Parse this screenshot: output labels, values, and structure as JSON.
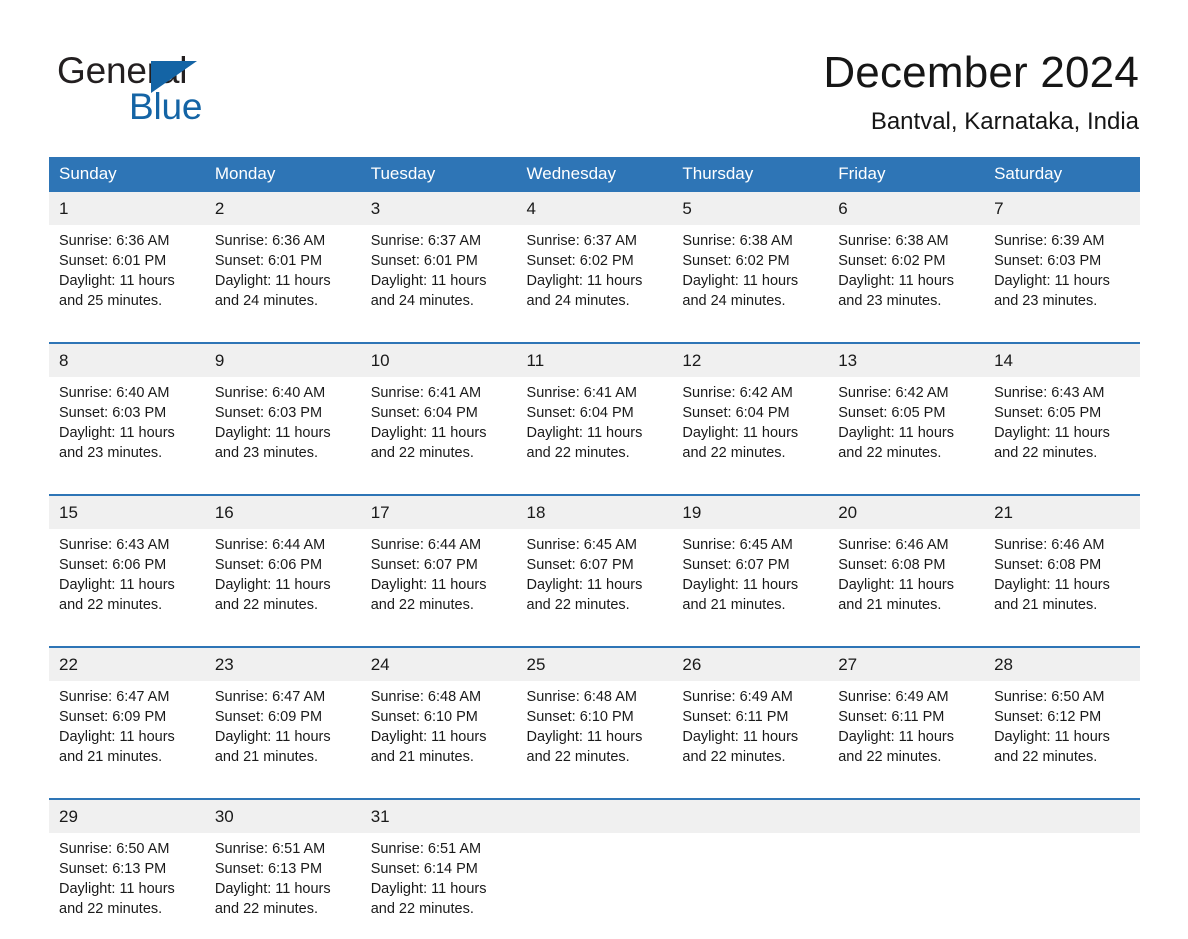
{
  "brand": {
    "name_part1": "General",
    "name_part2": "Blue",
    "triangle_icon": "triangle-play-icon",
    "accent_color": "#1464a5"
  },
  "header": {
    "title": "December 2024",
    "location": "Bantval, Karnataka, India"
  },
  "theme": {
    "header_blue": "#2e75b6",
    "daynum_band": "#f0f0f0",
    "text": "#1a1a1a",
    "page_background": "#ffffff"
  },
  "calendar": {
    "weekday_headers": [
      "Sunday",
      "Monday",
      "Tuesday",
      "Wednesday",
      "Thursday",
      "Friday",
      "Saturday"
    ],
    "weeks": [
      {
        "days": [
          {
            "date": "1",
            "sunrise": "Sunrise: 6:36 AM",
            "sunset": "Sunset: 6:01 PM",
            "daylight_line1": "Daylight: 11 hours",
            "daylight_line2": "and 25 minutes."
          },
          {
            "date": "2",
            "sunrise": "Sunrise: 6:36 AM",
            "sunset": "Sunset: 6:01 PM",
            "daylight_line1": "Daylight: 11 hours",
            "daylight_line2": "and 24 minutes."
          },
          {
            "date": "3",
            "sunrise": "Sunrise: 6:37 AM",
            "sunset": "Sunset: 6:01 PM",
            "daylight_line1": "Daylight: 11 hours",
            "daylight_line2": "and 24 minutes."
          },
          {
            "date": "4",
            "sunrise": "Sunrise: 6:37 AM",
            "sunset": "Sunset: 6:02 PM",
            "daylight_line1": "Daylight: 11 hours",
            "daylight_line2": "and 24 minutes."
          },
          {
            "date": "5",
            "sunrise": "Sunrise: 6:38 AM",
            "sunset": "Sunset: 6:02 PM",
            "daylight_line1": "Daylight: 11 hours",
            "daylight_line2": "and 24 minutes."
          },
          {
            "date": "6",
            "sunrise": "Sunrise: 6:38 AM",
            "sunset": "Sunset: 6:02 PM",
            "daylight_line1": "Daylight: 11 hours",
            "daylight_line2": "and 23 minutes."
          },
          {
            "date": "7",
            "sunrise": "Sunrise: 6:39 AM",
            "sunset": "Sunset: 6:03 PM",
            "daylight_line1": "Daylight: 11 hours",
            "daylight_line2": "and 23 minutes."
          }
        ]
      },
      {
        "days": [
          {
            "date": "8",
            "sunrise": "Sunrise: 6:40 AM",
            "sunset": "Sunset: 6:03 PM",
            "daylight_line1": "Daylight: 11 hours",
            "daylight_line2": "and 23 minutes."
          },
          {
            "date": "9",
            "sunrise": "Sunrise: 6:40 AM",
            "sunset": "Sunset: 6:03 PM",
            "daylight_line1": "Daylight: 11 hours",
            "daylight_line2": "and 23 minutes."
          },
          {
            "date": "10",
            "sunrise": "Sunrise: 6:41 AM",
            "sunset": "Sunset: 6:04 PM",
            "daylight_line1": "Daylight: 11 hours",
            "daylight_line2": "and 22 minutes."
          },
          {
            "date": "11",
            "sunrise": "Sunrise: 6:41 AM",
            "sunset": "Sunset: 6:04 PM",
            "daylight_line1": "Daylight: 11 hours",
            "daylight_line2": "and 22 minutes."
          },
          {
            "date": "12",
            "sunrise": "Sunrise: 6:42 AM",
            "sunset": "Sunset: 6:04 PM",
            "daylight_line1": "Daylight: 11 hours",
            "daylight_line2": "and 22 minutes."
          },
          {
            "date": "13",
            "sunrise": "Sunrise: 6:42 AM",
            "sunset": "Sunset: 6:05 PM",
            "daylight_line1": "Daylight: 11 hours",
            "daylight_line2": "and 22 minutes."
          },
          {
            "date": "14",
            "sunrise": "Sunrise: 6:43 AM",
            "sunset": "Sunset: 6:05 PM",
            "daylight_line1": "Daylight: 11 hours",
            "daylight_line2": "and 22 minutes."
          }
        ]
      },
      {
        "days": [
          {
            "date": "15",
            "sunrise": "Sunrise: 6:43 AM",
            "sunset": "Sunset: 6:06 PM",
            "daylight_line1": "Daylight: 11 hours",
            "daylight_line2": "and 22 minutes."
          },
          {
            "date": "16",
            "sunrise": "Sunrise: 6:44 AM",
            "sunset": "Sunset: 6:06 PM",
            "daylight_line1": "Daylight: 11 hours",
            "daylight_line2": "and 22 minutes."
          },
          {
            "date": "17",
            "sunrise": "Sunrise: 6:44 AM",
            "sunset": "Sunset: 6:07 PM",
            "daylight_line1": "Daylight: 11 hours",
            "daylight_line2": "and 22 minutes."
          },
          {
            "date": "18",
            "sunrise": "Sunrise: 6:45 AM",
            "sunset": "Sunset: 6:07 PM",
            "daylight_line1": "Daylight: 11 hours",
            "daylight_line2": "and 22 minutes."
          },
          {
            "date": "19",
            "sunrise": "Sunrise: 6:45 AM",
            "sunset": "Sunset: 6:07 PM",
            "daylight_line1": "Daylight: 11 hours",
            "daylight_line2": "and 21 minutes."
          },
          {
            "date": "20",
            "sunrise": "Sunrise: 6:46 AM",
            "sunset": "Sunset: 6:08 PM",
            "daylight_line1": "Daylight: 11 hours",
            "daylight_line2": "and 21 minutes."
          },
          {
            "date": "21",
            "sunrise": "Sunrise: 6:46 AM",
            "sunset": "Sunset: 6:08 PM",
            "daylight_line1": "Daylight: 11 hours",
            "daylight_line2": "and 21 minutes."
          }
        ]
      },
      {
        "days": [
          {
            "date": "22",
            "sunrise": "Sunrise: 6:47 AM",
            "sunset": "Sunset: 6:09 PM",
            "daylight_line1": "Daylight: 11 hours",
            "daylight_line2": "and 21 minutes."
          },
          {
            "date": "23",
            "sunrise": "Sunrise: 6:47 AM",
            "sunset": "Sunset: 6:09 PM",
            "daylight_line1": "Daylight: 11 hours",
            "daylight_line2": "and 21 minutes."
          },
          {
            "date": "24",
            "sunrise": "Sunrise: 6:48 AM",
            "sunset": "Sunset: 6:10 PM",
            "daylight_line1": "Daylight: 11 hours",
            "daylight_line2": "and 21 minutes."
          },
          {
            "date": "25",
            "sunrise": "Sunrise: 6:48 AM",
            "sunset": "Sunset: 6:10 PM",
            "daylight_line1": "Daylight: 11 hours",
            "daylight_line2": "and 22 minutes."
          },
          {
            "date": "26",
            "sunrise": "Sunrise: 6:49 AM",
            "sunset": "Sunset: 6:11 PM",
            "daylight_line1": "Daylight: 11 hours",
            "daylight_line2": "and 22 minutes."
          },
          {
            "date": "27",
            "sunrise": "Sunrise: 6:49 AM",
            "sunset": "Sunset: 6:11 PM",
            "daylight_line1": "Daylight: 11 hours",
            "daylight_line2": "and 22 minutes."
          },
          {
            "date": "28",
            "sunrise": "Sunrise: 6:50 AM",
            "sunset": "Sunset: 6:12 PM",
            "daylight_line1": "Daylight: 11 hours",
            "daylight_line2": "and 22 minutes."
          }
        ]
      },
      {
        "days": [
          {
            "date": "29",
            "sunrise": "Sunrise: 6:50 AM",
            "sunset": "Sunset: 6:13 PM",
            "daylight_line1": "Daylight: 11 hours",
            "daylight_line2": "and 22 minutes."
          },
          {
            "date": "30",
            "sunrise": "Sunrise: 6:51 AM",
            "sunset": "Sunset: 6:13 PM",
            "daylight_line1": "Daylight: 11 hours",
            "daylight_line2": "and 22 minutes."
          },
          {
            "date": "31",
            "sunrise": "Sunrise: 6:51 AM",
            "sunset": "Sunset: 6:14 PM",
            "daylight_line1": "Daylight: 11 hours",
            "daylight_line2": "and 22 minutes."
          },
          {
            "date": "",
            "sunrise": "",
            "sunset": "",
            "daylight_line1": "",
            "daylight_line2": ""
          },
          {
            "date": "",
            "sunrise": "",
            "sunset": "",
            "daylight_line1": "",
            "daylight_line2": ""
          },
          {
            "date": "",
            "sunrise": "",
            "sunset": "",
            "daylight_line1": "",
            "daylight_line2": ""
          },
          {
            "date": "",
            "sunrise": "",
            "sunset": "",
            "daylight_line1": "",
            "daylight_line2": ""
          }
        ]
      }
    ]
  }
}
